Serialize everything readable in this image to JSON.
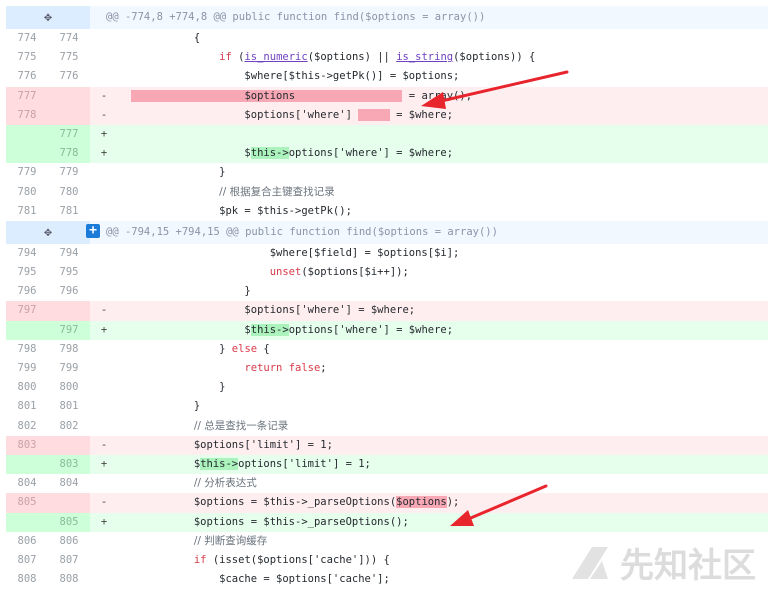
{
  "hunks": [
    {
      "header": "@@ -774,8 +774,8 @@ public function find($options = array())",
      "rows": [
        {
          "type": "ctx",
          "old": "774",
          "new": "774",
          "marker": "",
          "segs": [
            {
              "t": "            {",
              "c": "v"
            }
          ]
        },
        {
          "type": "ctx",
          "old": "775",
          "new": "775",
          "marker": "",
          "segs": [
            {
              "t": "                ",
              "c": "v"
            },
            {
              "t": "if",
              "c": "k"
            },
            {
              "t": " (",
              "c": "v"
            },
            {
              "t": "is_numeric",
              "c": "f u"
            },
            {
              "t": "($options) || ",
              "c": "v"
            },
            {
              "t": "is_string",
              "c": "f u"
            },
            {
              "t": "($options)) {",
              "c": "v"
            }
          ]
        },
        {
          "type": "ctx",
          "old": "776",
          "new": "776",
          "marker": "",
          "segs": [
            {
              "t": "                    $where[$this->getPk()] = $options;",
              "c": "v"
            }
          ]
        },
        {
          "type": "del",
          "old": "777",
          "new": "",
          "marker": "-",
          "segs": [
            {
              "t": "  ",
              "c": "v"
            },
            {
              "t": "                  $options                 ",
              "c": "hl-del"
            },
            {
              "t": " = array();",
              "c": "v"
            }
          ]
        },
        {
          "type": "del",
          "old": "778",
          "new": "",
          "marker": "-",
          "segs": [
            {
              "t": "                    $options['where'] ",
              "c": "v"
            },
            {
              "t": "     ",
              "c": "hl-del"
            },
            {
              "t": " = $where;",
              "c": "v"
            }
          ]
        },
        {
          "type": "add",
          "old": "",
          "new": "777",
          "marker": "+",
          "segs": [
            {
              "t": "",
              "c": "v"
            }
          ]
        },
        {
          "type": "add",
          "old": "",
          "new": "778",
          "marker": "+",
          "segs": [
            {
              "t": "                    $",
              "c": "v"
            },
            {
              "t": "this->",
              "c": "hl-add"
            },
            {
              "t": "options['where'] = $where;",
              "c": "v"
            }
          ]
        },
        {
          "type": "ctx",
          "old": "779",
          "new": "779",
          "marker": "",
          "segs": [
            {
              "t": "                }",
              "c": "v"
            }
          ]
        },
        {
          "type": "ctx",
          "old": "780",
          "new": "780",
          "marker": "",
          "segs": [
            {
              "t": "                ",
              "c": "v"
            },
            {
              "t": "// 根据复合主键查找记录",
              "c": "c"
            }
          ]
        },
        {
          "type": "ctx",
          "old": "781",
          "new": "781",
          "marker": "",
          "segs": [
            {
              "t": "                $pk = $this->getPk();",
              "c": "v"
            }
          ]
        }
      ]
    },
    {
      "header": "@@ -794,15 +794,15 @@ public function find($options = array())",
      "rows": [
        {
          "type": "ctx",
          "old": "794",
          "new": "794",
          "marker": "",
          "segs": [
            {
              "t": "                        $where[$field] = $options[$i];",
              "c": "v"
            }
          ]
        },
        {
          "type": "ctx",
          "old": "795",
          "new": "795",
          "marker": "",
          "segs": [
            {
              "t": "                        ",
              "c": "v"
            },
            {
              "t": "unset",
              "c": "k"
            },
            {
              "t": "($options[$i++]);",
              "c": "v"
            }
          ]
        },
        {
          "type": "ctx",
          "old": "796",
          "new": "796",
          "marker": "",
          "segs": [
            {
              "t": "                    }",
              "c": "v"
            }
          ]
        },
        {
          "type": "del",
          "old": "797",
          "new": "",
          "marker": "-",
          "segs": [
            {
              "t": "                    $options['where'] = $where;",
              "c": "v"
            }
          ]
        },
        {
          "type": "add",
          "old": "",
          "new": "797",
          "marker": "+",
          "segs": [
            {
              "t": "                    $",
              "c": "v"
            },
            {
              "t": "this->",
              "c": "hl-add"
            },
            {
              "t": "options['where'] = $where;",
              "c": "v"
            }
          ]
        },
        {
          "type": "ctx",
          "old": "798",
          "new": "798",
          "marker": "",
          "segs": [
            {
              "t": "                } ",
              "c": "v"
            },
            {
              "t": "else",
              "c": "k"
            },
            {
              "t": " {",
              "c": "v"
            }
          ]
        },
        {
          "type": "ctx",
          "old": "799",
          "new": "799",
          "marker": "",
          "segs": [
            {
              "t": "                    ",
              "c": "v"
            },
            {
              "t": "return false",
              "c": "k"
            },
            {
              "t": ";",
              "c": "v"
            }
          ]
        },
        {
          "type": "ctx",
          "old": "800",
          "new": "800",
          "marker": "",
          "segs": [
            {
              "t": "                }",
              "c": "v"
            }
          ]
        },
        {
          "type": "ctx",
          "old": "801",
          "new": "801",
          "marker": "",
          "segs": [
            {
              "t": "            }",
              "c": "v"
            }
          ]
        },
        {
          "type": "ctx",
          "old": "802",
          "new": "802",
          "marker": "",
          "segs": [
            {
              "t": "            ",
              "c": "v"
            },
            {
              "t": "// 总是查找一条记录",
              "c": "c"
            }
          ]
        },
        {
          "type": "del",
          "old": "803",
          "new": "",
          "marker": "-",
          "segs": [
            {
              "t": "            $options['limit'] = 1;",
              "c": "v"
            }
          ]
        },
        {
          "type": "add",
          "old": "",
          "new": "803",
          "marker": "+",
          "segs": [
            {
              "t": "            $",
              "c": "v"
            },
            {
              "t": "this->",
              "c": "hl-add"
            },
            {
              "t": "options['limit'] = 1;",
              "c": "v"
            }
          ]
        },
        {
          "type": "ctx",
          "old": "804",
          "new": "804",
          "marker": "",
          "segs": [
            {
              "t": "            ",
              "c": "v"
            },
            {
              "t": "// 分析表达式",
              "c": "c"
            }
          ]
        },
        {
          "type": "del",
          "old": "805",
          "new": "",
          "marker": "-",
          "segs": [
            {
              "t": "            $options = $this->_parseOptions(",
              "c": "v"
            },
            {
              "t": "$options",
              "c": "hl-del"
            },
            {
              "t": ");",
              "c": "v"
            }
          ]
        },
        {
          "type": "add",
          "old": "",
          "new": "805",
          "marker": "+",
          "segs": [
            {
              "t": "            $options = $this->_parseOptions();",
              "c": "v"
            }
          ]
        },
        {
          "type": "ctx",
          "old": "806",
          "new": "806",
          "marker": "",
          "segs": [
            {
              "t": "            ",
              "c": "v"
            },
            {
              "t": "// 判断查询缓存",
              "c": "c"
            }
          ]
        },
        {
          "type": "ctx",
          "old": "807",
          "new": "807",
          "marker": "",
          "segs": [
            {
              "t": "            ",
              "c": "v"
            },
            {
              "t": "if",
              "c": "k"
            },
            {
              "t": " (isset($options['cache'])) {",
              "c": "v"
            }
          ]
        },
        {
          "type": "ctx",
          "old": "808",
          "new": "808",
          "marker": "",
          "segs": [
            {
              "t": "                $cache = $options['cache'];",
              "c": "v"
            }
          ]
        }
      ]
    }
  ],
  "expand_icon": "expand-arrows-icon",
  "plus_label": "+",
  "watermark": "先知社区",
  "colors": {
    "del_bg": "#ffeef0",
    "add_bg": "#e6ffed",
    "hunk_bg": "#f1f8ff",
    "arrow": "#e8242c"
  }
}
